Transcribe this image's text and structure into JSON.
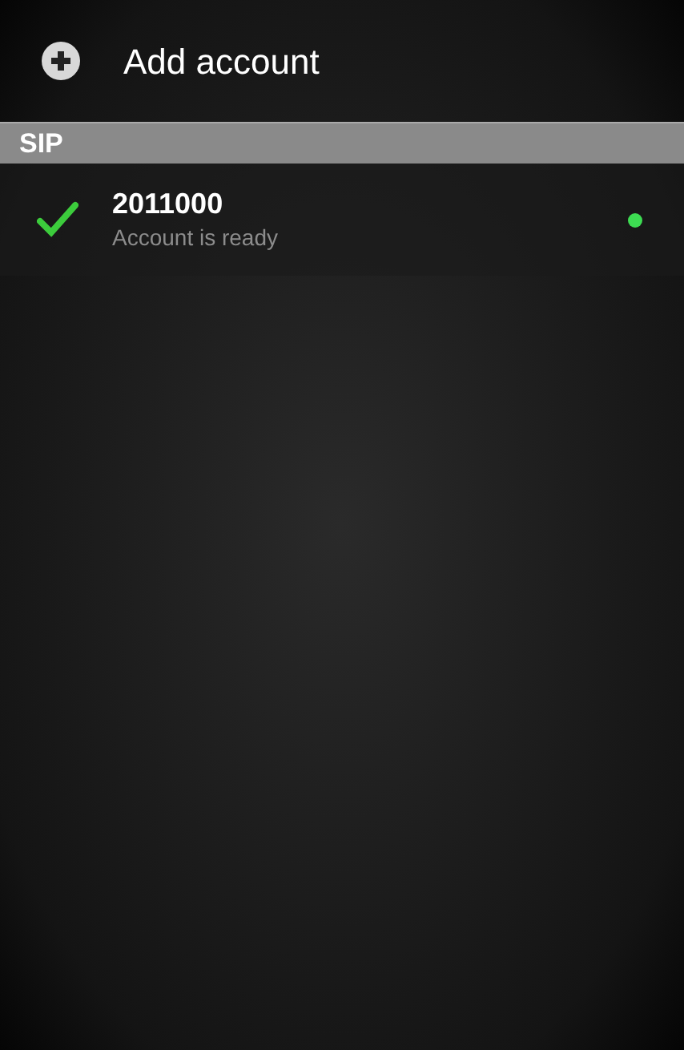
{
  "add_account": {
    "label": "Add account"
  },
  "sections": [
    {
      "title": "SIP",
      "accounts": [
        {
          "name": "2011000",
          "status": "Account is ready",
          "active": true,
          "color": "#3ddc52"
        }
      ]
    }
  ]
}
